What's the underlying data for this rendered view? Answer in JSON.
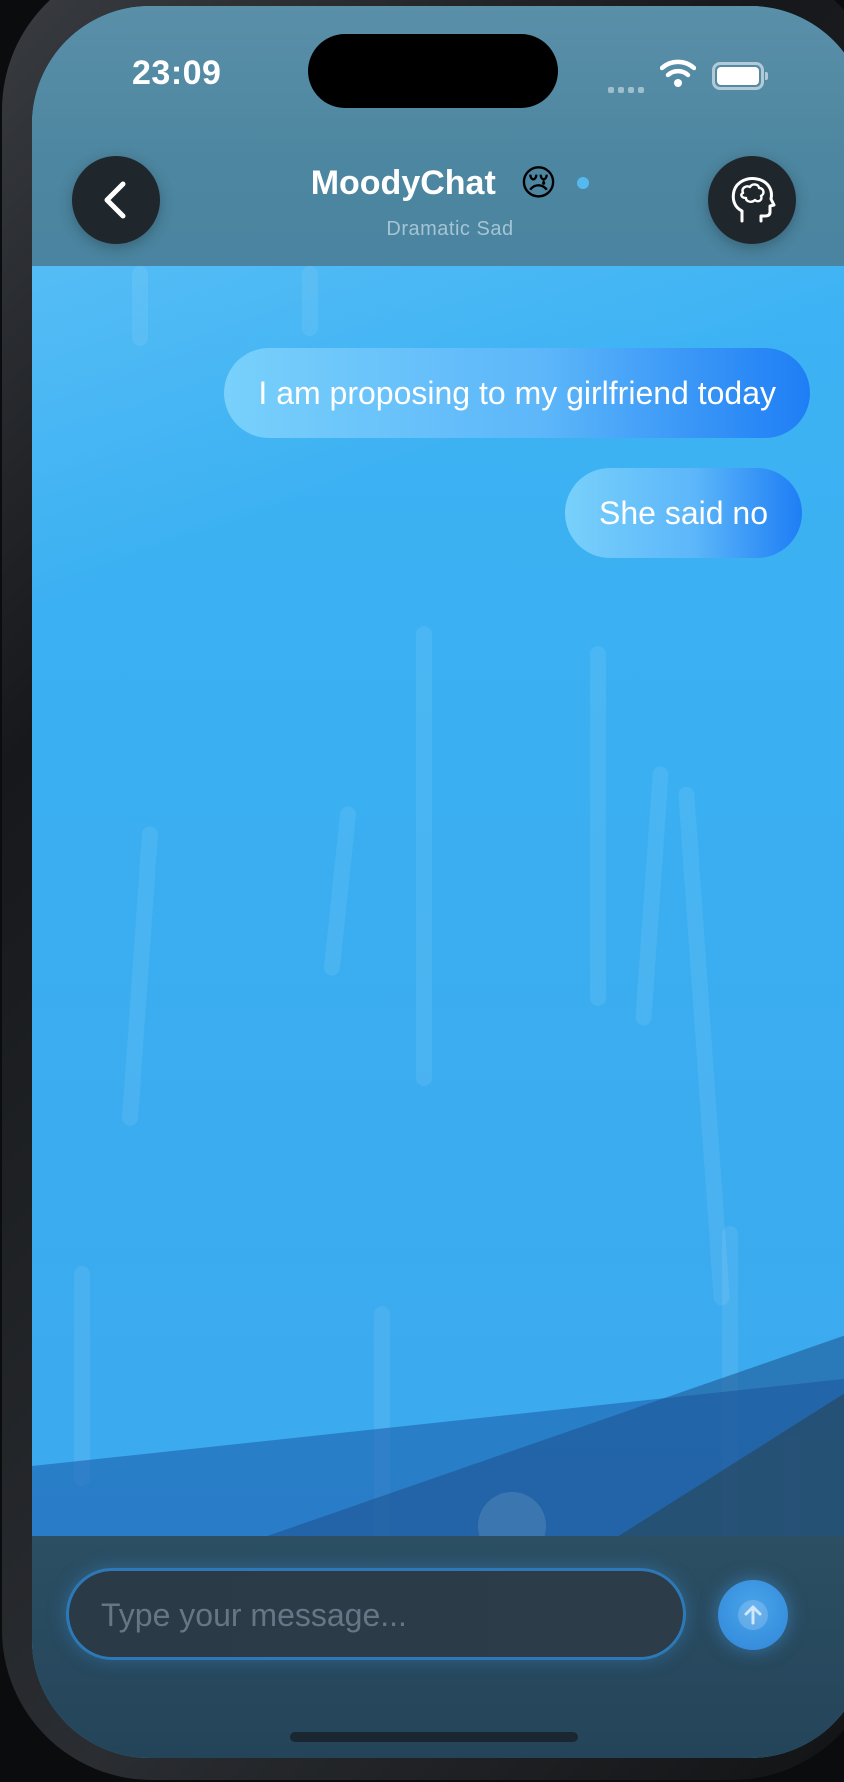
{
  "status_bar": {
    "time": "23:09"
  },
  "header": {
    "title": "MoodyChat",
    "mood_emoji": "😢",
    "subtitle": "Dramatic Sad",
    "back_icon": "chevron-left-icon",
    "mood_settings_icon": "brain-head-icon"
  },
  "messages": [
    {
      "text": "I am proposing to my girlfriend today",
      "sender": "user"
    },
    {
      "text": "She said no",
      "sender": "user"
    }
  ],
  "composer": {
    "placeholder": "Type your message...",
    "value": "",
    "send_icon": "arrow-up-icon"
  },
  "colors": {
    "accent": "#2e8cf6",
    "chat_background": "#3aaef2",
    "header_background": "#4d86a0"
  }
}
